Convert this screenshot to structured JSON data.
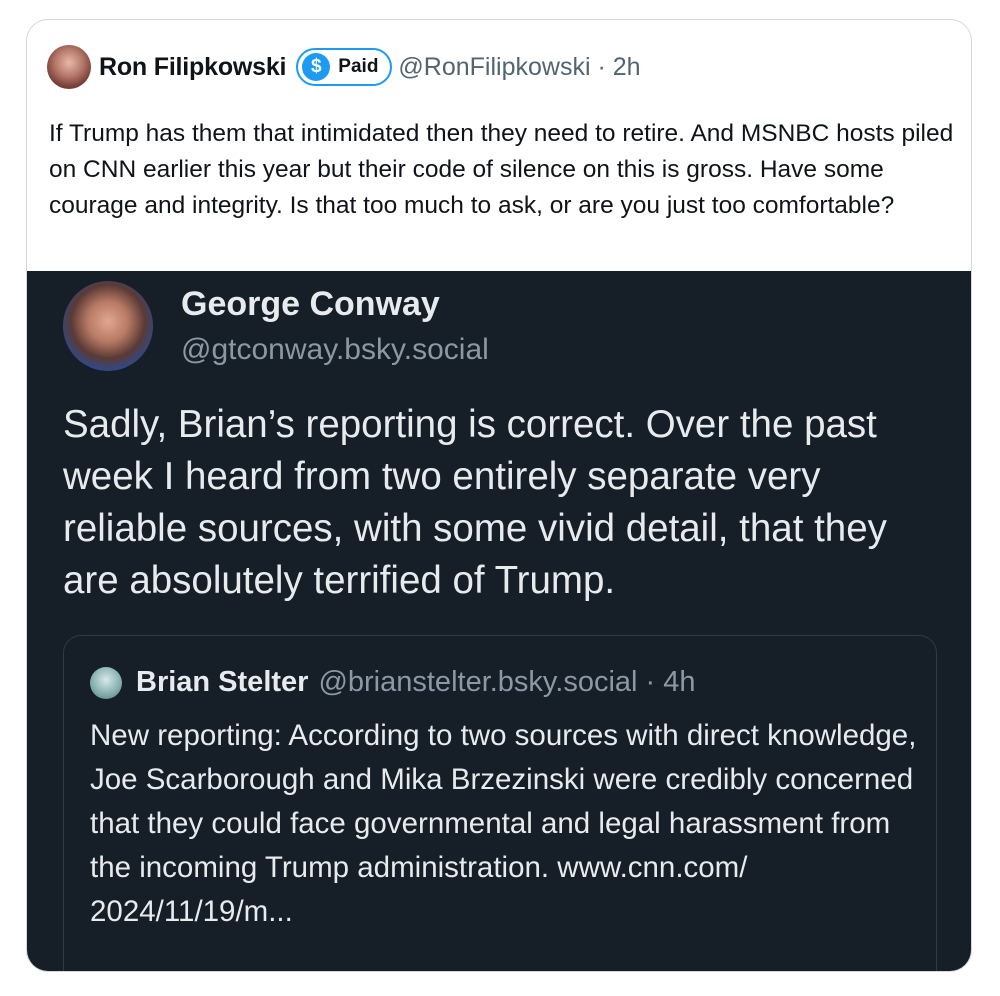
{
  "tweet": {
    "author_name": "Ron Filipkowski",
    "badge_icon": "$",
    "badge_label": "Paid",
    "handle_time": "@RonFilipkowski · 2h",
    "text": "If Trump has them that intimidated then they need to retire. And MSNBC hosts piled on CNN earlier this year but their code of silence on this is gross. Have some courage and integrity. Is that too much to ask, or are you just too comfortable?"
  },
  "embedded_post": {
    "author_name": "George Conway",
    "handle": "@gtconway.bsky.social",
    "text": "Sadly, Brian’s reporting is correct.   Over the past week I heard from two entirely separate very reliable sources, with some vivid detail, that they are absolutely terrified of Trump.",
    "quoted_post": {
      "author_name": "Brian Stelter",
      "handle_time": "@brianstelter.bsky.social · 4h",
      "text": "New reporting: According to two sources with direct knowledge, Joe Scarborough and Mika Brzezinski were credibly concerned that they could face governmental and legal harassment from the incoming Trump administration. www.cnn.com/ 2024/11/19/m..."
    }
  },
  "colors": {
    "paid_blue": "#1d9bf0",
    "dark_background": "#161e27",
    "muted_text": "#8b98a5"
  }
}
